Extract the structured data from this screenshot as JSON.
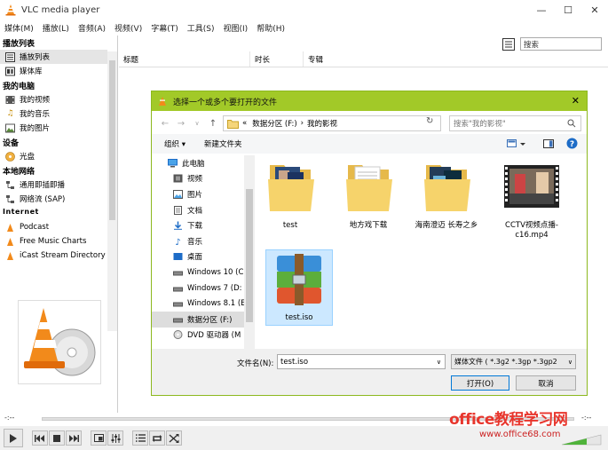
{
  "window": {
    "title": "VLC media player",
    "minimize": "—",
    "maximize": "☐",
    "close": "✕"
  },
  "menu": [
    "媒体(M)",
    "播放(L)",
    "音频(A)",
    "视频(V)",
    "字幕(T)",
    "工具(S)",
    "视图(I)",
    "帮助(H)"
  ],
  "sidebar": {
    "sections": [
      {
        "title": "播放列表",
        "items": [
          {
            "label": "播放列表",
            "icon": "playlist-icon",
            "active": true
          },
          {
            "label": "媒体库",
            "icon": "library-icon"
          }
        ]
      },
      {
        "title": "我的电脑",
        "items": [
          {
            "label": "我的视频",
            "icon": "video-icon"
          },
          {
            "label": "我的音乐",
            "icon": "music-icon"
          },
          {
            "label": "我的图片",
            "icon": "picture-icon"
          }
        ]
      },
      {
        "title": "设备",
        "items": [
          {
            "label": "光盘",
            "icon": "disc-icon"
          }
        ]
      },
      {
        "title": "本地网络",
        "items": [
          {
            "label": "通用即插即播",
            "icon": "network-icon"
          },
          {
            "label": "网络流 (SAP)",
            "icon": "network-icon"
          }
        ]
      },
      {
        "title": "Internet",
        "items": [
          {
            "label": "Podcast",
            "icon": "podcast-icon"
          },
          {
            "label": "Free Music Charts",
            "icon": "charts-icon"
          },
          {
            "label": "iCast Stream Directory",
            "icon": "icast-icon"
          }
        ]
      }
    ]
  },
  "playlist": {
    "search_placeholder": "搜索",
    "columns": [
      "标题",
      "时长",
      "专辑"
    ]
  },
  "dialog": {
    "title": "选择一个或多个要打开的文件",
    "close": "✕",
    "breadcrumb": [
      "«",
      "数据分区 (F:)",
      "›",
      "我的影视"
    ],
    "search_placeholder": "搜索\"我的影视\"",
    "commands": {
      "organize": "组织 ▾",
      "new_folder": "新建文件夹"
    },
    "nav_items": [
      {
        "label": "此电脑",
        "icon": "computer-icon",
        "level": 0
      },
      {
        "label": "视频",
        "icon": "video-folder-icon",
        "level": 1
      },
      {
        "label": "图片",
        "icon": "picture-folder-icon",
        "level": 1
      },
      {
        "label": "文档",
        "icon": "document-folder-icon",
        "level": 1
      },
      {
        "label": "下载",
        "icon": "download-folder-icon",
        "level": 1
      },
      {
        "label": "音乐",
        "icon": "music-folder-icon",
        "level": 1
      },
      {
        "label": "桌面",
        "icon": "desktop-folder-icon",
        "level": 1
      },
      {
        "label": "Windows 10 (C",
        "icon": "drive-icon",
        "level": 1
      },
      {
        "label": "Windows 7 (D:",
        "icon": "drive-icon",
        "level": 1
      },
      {
        "label": "Windows 8.1 (E",
        "icon": "drive-icon",
        "level": 1
      },
      {
        "label": "数据分区 (F:)",
        "icon": "drive-icon",
        "level": 1,
        "selected": true
      },
      {
        "label": "DVD 驱动器 (M",
        "icon": "dvd-icon",
        "level": 1
      }
    ],
    "files": [
      {
        "name": "test",
        "type": "folder-with-video"
      },
      {
        "name": "地方戏下载",
        "type": "folder-with-docs"
      },
      {
        "name": "海南澄迈 长寿之乡",
        "type": "folder-with-video"
      },
      {
        "name": "CCTV视频点播-c16.mp4",
        "type": "video-file"
      },
      {
        "name": "test.iso",
        "type": "winrar-archive",
        "selected": true
      }
    ],
    "filename_label": "文件名(N):",
    "filename_value": "test.iso",
    "filetype_value": "媒体文件 ( *.3g2 *.3gp *.3gp2",
    "open_label": "打开(O)",
    "cancel_label": "取消"
  },
  "player": {
    "time_elapsed": "-:--",
    "time_total": "-:--"
  },
  "watermark": {
    "text": "office教程学习网",
    "url": "www.office68.com"
  }
}
